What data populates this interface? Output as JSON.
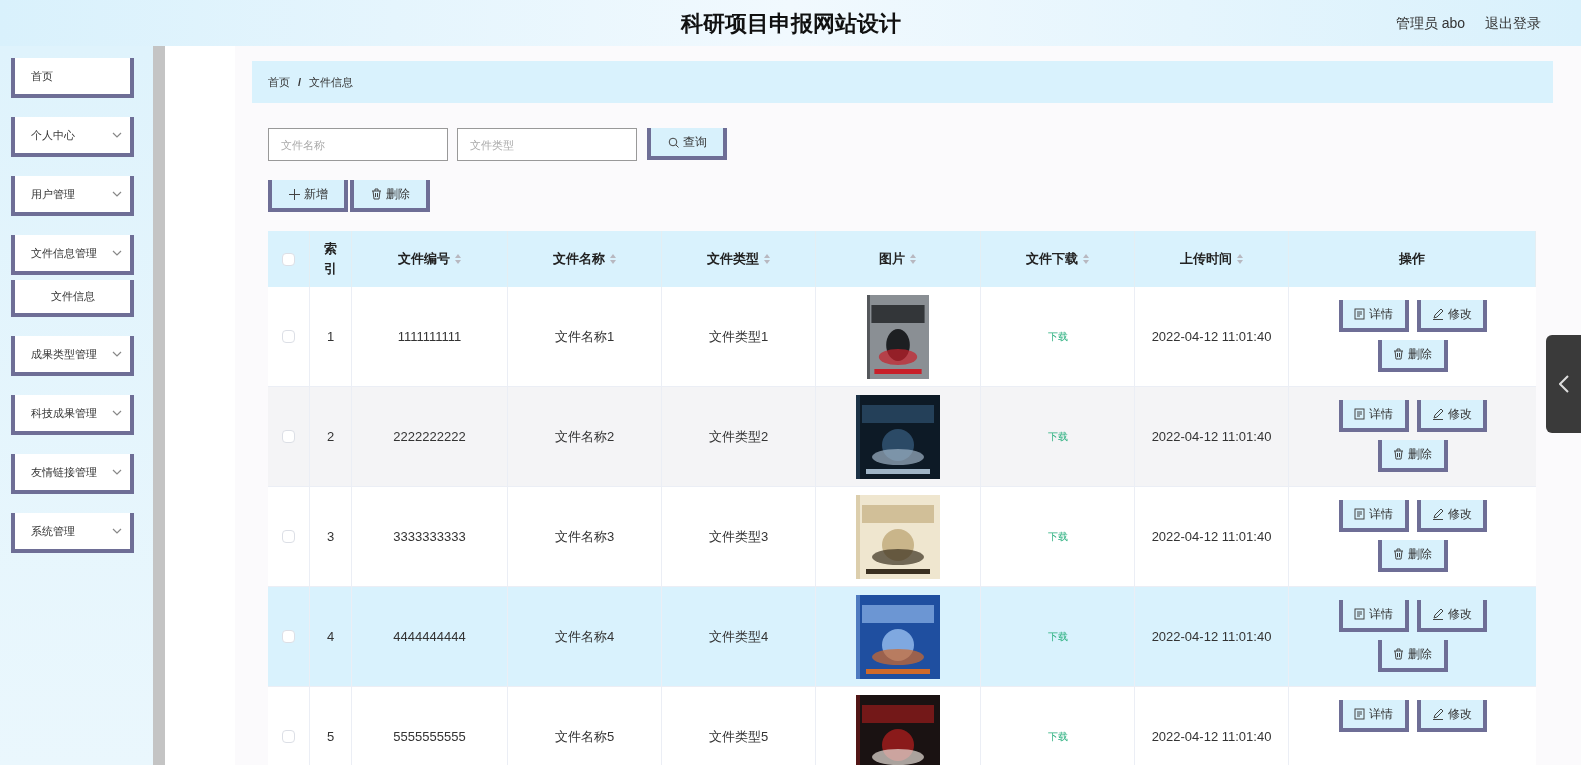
{
  "header": {
    "title": "科研项目申报网站设计",
    "user": "管理员 abo",
    "logout": "退出登录"
  },
  "sidebar": {
    "items": [
      {
        "label": "首页",
        "has_submenu": false
      },
      {
        "label": "个人中心",
        "has_submenu": true
      },
      {
        "label": "用户管理",
        "has_submenu": true
      },
      {
        "label": "文件信息管理",
        "has_submenu": true,
        "children": [
          {
            "label": "文件信息"
          }
        ]
      },
      {
        "label": "成果类型管理",
        "has_submenu": true
      },
      {
        "label": "科技成果管理",
        "has_submenu": true
      },
      {
        "label": "友情链接管理",
        "has_submenu": true
      },
      {
        "label": "系统管理",
        "has_submenu": true
      }
    ]
  },
  "breadcrumb": {
    "items": [
      "首页",
      "文件信息"
    ],
    "separator": "/"
  },
  "search": {
    "fields": [
      {
        "placeholder": "文件名称"
      },
      {
        "placeholder": "文件类型"
      }
    ],
    "button": "查询"
  },
  "toolbar": [
    {
      "kind": "add",
      "label": "新增"
    },
    {
      "kind": "delete",
      "label": "删除"
    }
  ],
  "table": {
    "header_checked": false,
    "columns": [
      {
        "label": "索引",
        "sortable": false
      },
      {
        "label": "文件编号",
        "sortable": true
      },
      {
        "label": "文件名称",
        "sortable": true
      },
      {
        "label": "文件类型",
        "sortable": true
      },
      {
        "label": "图片",
        "sortable": true
      },
      {
        "label": "文件下载",
        "sortable": true
      },
      {
        "label": "上传时间",
        "sortable": true
      },
      {
        "label": "操作",
        "sortable": false
      }
    ],
    "rows": [
      {
        "checked": false,
        "highlighted": false,
        "index": "1",
        "code": "1111111111",
        "name": "文件名称1",
        "type": "文件类型1",
        "download": "下载",
        "time": "2022-04-12 11:01:40",
        "actions": [
          {
            "kind": "detail",
            "label": "详情"
          },
          {
            "kind": "edit",
            "label": "修改"
          },
          {
            "kind": "delete",
            "label": "删除"
          }
        ]
      },
      {
        "checked": false,
        "highlighted": false,
        "index": "2",
        "code": "2222222222",
        "name": "文件名称2",
        "type": "文件类型2",
        "download": "下载",
        "time": "2022-04-12 11:01:40",
        "actions": [
          {
            "kind": "detail",
            "label": "详情"
          },
          {
            "kind": "edit",
            "label": "修改"
          },
          {
            "kind": "delete",
            "label": "删除"
          }
        ]
      },
      {
        "checked": false,
        "highlighted": false,
        "index": "3",
        "code": "3333333333",
        "name": "文件名称3",
        "type": "文件类型3",
        "download": "下载",
        "time": "2022-04-12 11:01:40",
        "actions": [
          {
            "kind": "detail",
            "label": "详情"
          },
          {
            "kind": "edit",
            "label": "修改"
          },
          {
            "kind": "delete",
            "label": "删除"
          }
        ]
      },
      {
        "checked": false,
        "highlighted": true,
        "index": "4",
        "code": "4444444444",
        "name": "文件名称4",
        "type": "文件类型4",
        "download": "下载",
        "time": "2022-04-12 11:01:40",
        "actions": [
          {
            "kind": "detail",
            "label": "详情"
          },
          {
            "kind": "edit",
            "label": "修改"
          },
          {
            "kind": "delete",
            "label": "删除"
          }
        ]
      },
      {
        "checked": false,
        "highlighted": false,
        "index": "5",
        "code": "5555555555",
        "name": "文件名称5",
        "type": "文件类型5",
        "download": "下载",
        "time": "2022-04-12 11:01:40",
        "actions": [
          {
            "kind": "detail",
            "label": "详情"
          },
          {
            "kind": "edit",
            "label": "修改"
          }
        ]
      }
    ]
  }
}
